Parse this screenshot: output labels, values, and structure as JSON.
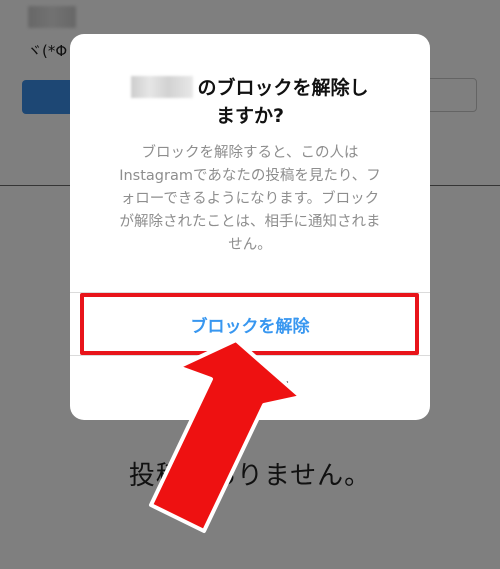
{
  "background": {
    "bio_text": "ヾ(*Φ",
    "empty_posts_text": "投稿がありません。"
  },
  "dialog": {
    "title_line1_suffix": "のブロックを解除し",
    "title_line2": "ますか?",
    "body_lines": [
      "ブロックを解除すると、この人は",
      "Instagramであなたの投稿を見たり、フ",
      "ォローできるようになります。ブロック",
      "が解除されたことは、相手に通知されま",
      "せん。"
    ],
    "unblock_label": "ブロックを解除",
    "cancel_label": "キャンセル"
  },
  "colors": {
    "accent_blue": "#3897f0",
    "highlight_red": "#e8141a",
    "overlay": "rgba(0,0,0,0.5)"
  }
}
